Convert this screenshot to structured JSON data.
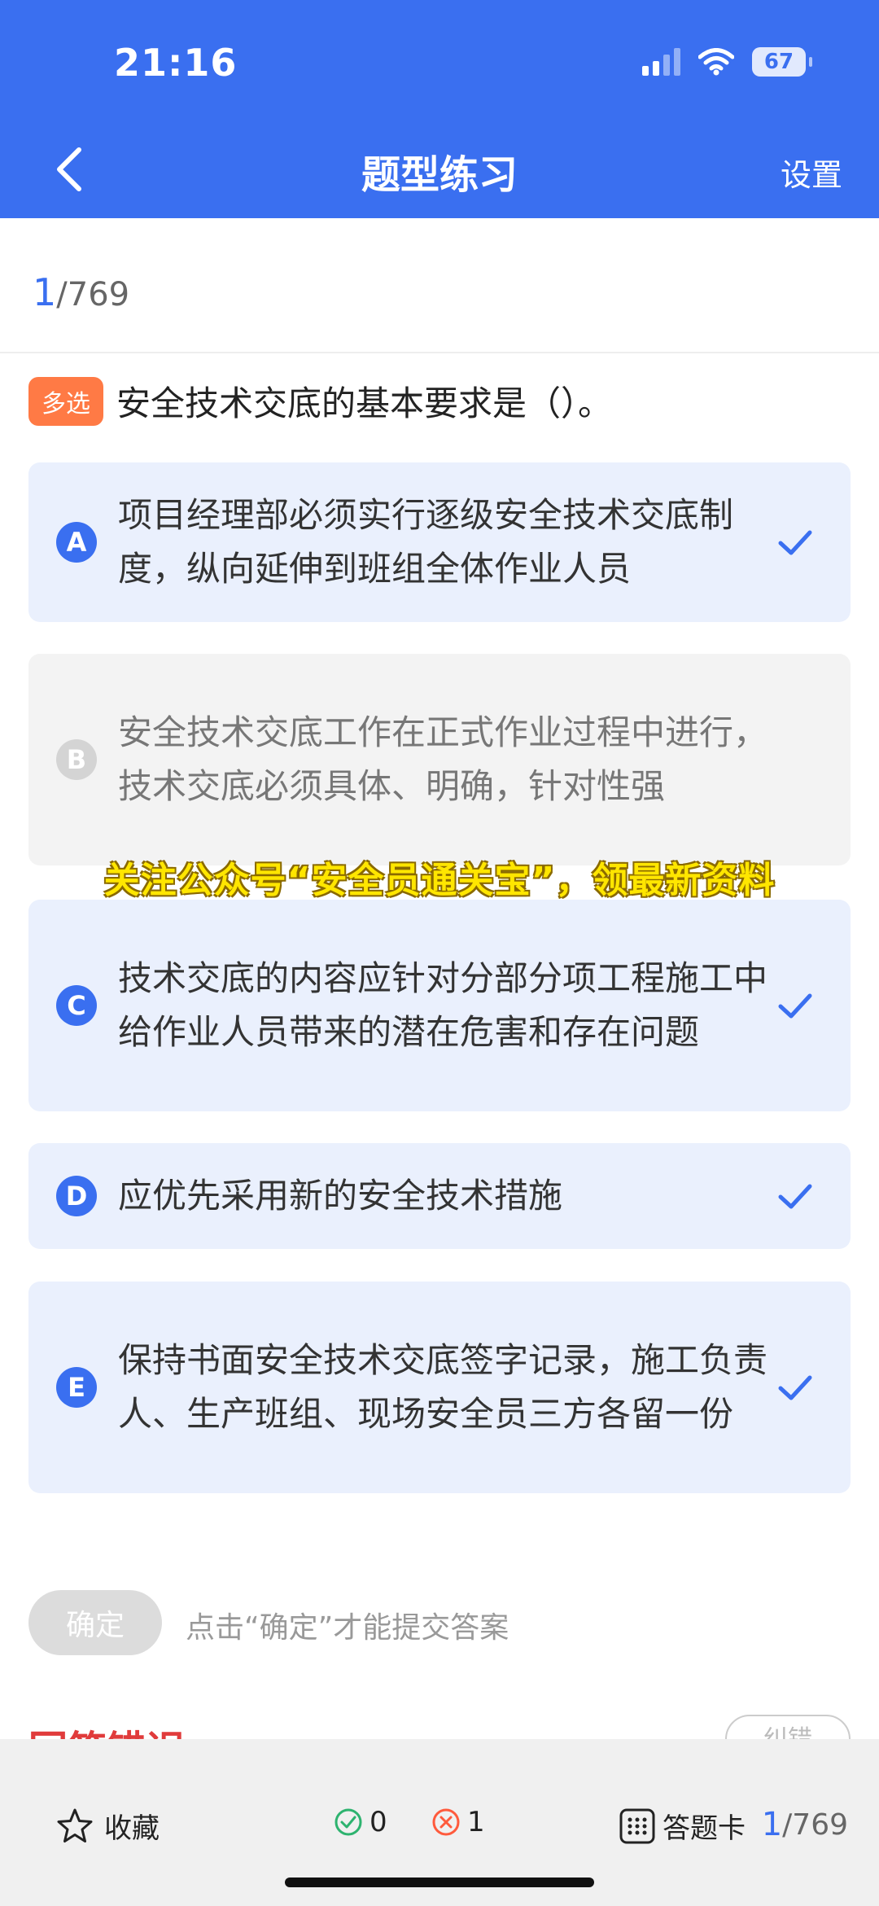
{
  "status_bar": {
    "time": "21:16",
    "battery": "67"
  },
  "header": {
    "title": "题型练习",
    "settings_label": "设置"
  },
  "progress": {
    "current": "1",
    "total": "/769"
  },
  "question": {
    "tag": "多选",
    "text": "安全技术交底的基本要求是（）。"
  },
  "options": [
    {
      "letter": "A",
      "text": "项目经理部必须实行逐级安全技术交底制度，纵向延伸到班组全体作业人员",
      "selected": true
    },
    {
      "letter": "B",
      "text": "安全技术交底工作在正式作业过程中进行，技术交底必须具体、明确，针对性强",
      "selected": false
    },
    {
      "letter": "C",
      "text": "技术交底的内容应针对分部分项工程施工中给作业人员带来的潜在危害和存在问题",
      "selected": true
    },
    {
      "letter": "D",
      "text": "应优先采用新的安全技术措施",
      "selected": true
    },
    {
      "letter": "E",
      "text": "保持书面安全技术交底签字记录，施工负责人、生产班组、现场安全员三方各留一份",
      "selected": true
    }
  ],
  "watermark": "关注公众号“安全员通关宝”，领最新资料",
  "confirm": {
    "label": "确定",
    "hint": "点击“确定”才能提交答案"
  },
  "result": {
    "label": "回答错误",
    "correct_button": "纠错"
  },
  "bottom_bar": {
    "favorite_label": "收藏",
    "correct_count": "0",
    "wrong_count": "1",
    "answer_card_label": "答题卡",
    "progress_current": "1",
    "progress_total": "/769"
  },
  "colors": {
    "primary": "#3a6ff0",
    "tag": "#ff7a45",
    "correct": "#2db36f",
    "wrong": "#ff5a3c"
  }
}
